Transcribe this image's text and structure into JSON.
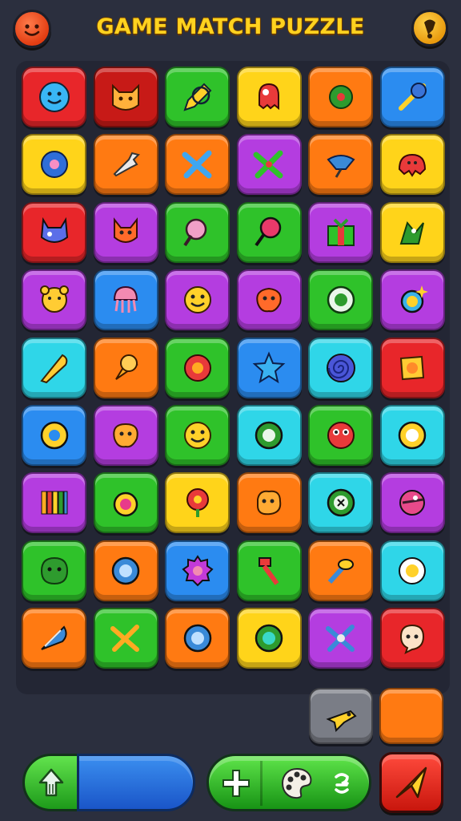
{
  "header": {
    "title": "GAME MATCH PUZZLE",
    "avatar_icon": "smiley-face-icon",
    "settings_icon": "bell-icon"
  },
  "colors": {
    "red": "#e8262a",
    "darkred": "#c71a17",
    "green": "#2fc22a",
    "yellow": "#ffd41a",
    "orange": "#ff7a12",
    "blue": "#2b8cf0",
    "purple": "#b43de0",
    "cyan": "#2fd6e8",
    "gray": "#7a7d86"
  },
  "board": {
    "rows": [
      [
        {
          "color": "red",
          "icon": "blue-smiley-icon"
        },
        {
          "color": "darkred",
          "icon": "cat-face-icon"
        },
        {
          "color": "green",
          "icon": "pencil-icon"
        },
        {
          "color": "yellow",
          "icon": "ghost-icon"
        },
        {
          "color": "orange",
          "icon": "gear-icon"
        },
        {
          "color": "blue",
          "icon": "broom-icon"
        }
      ],
      [
        {
          "color": "yellow",
          "icon": "donut-icon"
        },
        {
          "color": "orange",
          "icon": "wrench-icon"
        },
        {
          "color": "orange",
          "icon": "crossed-tools-icon"
        },
        {
          "color": "purple",
          "icon": "crossed-swords-icon"
        },
        {
          "color": "orange",
          "icon": "watering-can-icon"
        },
        {
          "color": "yellow",
          "icon": "red-monster-icon"
        }
      ],
      [
        {
          "color": "red",
          "icon": "horned-monster-icon"
        },
        {
          "color": "purple",
          "icon": "fox-face-icon"
        },
        {
          "color": "green",
          "icon": "lollipop-icon"
        },
        {
          "color": "green",
          "icon": "magnifier-icon"
        },
        {
          "color": "purple",
          "icon": "gift-box-icon"
        },
        {
          "color": "yellow",
          "icon": "bird-icon"
        }
      ],
      [
        {
          "color": "purple",
          "icon": "bear-face-icon"
        },
        {
          "color": "blue",
          "icon": "jellyfish-icon"
        },
        {
          "color": "purple",
          "icon": "yellow-smiley-icon"
        },
        {
          "color": "purple",
          "icon": "orange-blob-icon"
        },
        {
          "color": "green",
          "icon": "target-bubble-icon"
        },
        {
          "color": "purple",
          "icon": "sparkle-ring-icon"
        }
      ],
      [
        {
          "color": "cyan",
          "icon": "corn-cob-icon"
        },
        {
          "color": "orange",
          "icon": "carrot-icon"
        },
        {
          "color": "green",
          "icon": "flower-icon"
        },
        {
          "color": "blue",
          "icon": "star-icon"
        },
        {
          "color": "cyan",
          "icon": "spiral-icon"
        },
        {
          "color": "red",
          "icon": "swirl-candy-icon"
        }
      ],
      [
        {
          "color": "blue",
          "icon": "yellow-bubble-icon"
        },
        {
          "color": "purple",
          "icon": "blob-face-icon"
        },
        {
          "color": "green",
          "icon": "happy-face-icon"
        },
        {
          "color": "cyan",
          "icon": "green-bubble-icon"
        },
        {
          "color": "green",
          "icon": "red-monster-face-icon"
        },
        {
          "color": "cyan",
          "icon": "egg-icon"
        }
      ],
      [
        {
          "color": "purple",
          "icon": "crayons-icon"
        },
        {
          "color": "green",
          "icon": "potion-bubble-icon"
        },
        {
          "color": "yellow",
          "icon": "flower-bud-icon"
        },
        {
          "color": "orange",
          "icon": "cookie-icon"
        },
        {
          "color": "cyan",
          "icon": "clock-bubble-icon"
        },
        {
          "color": "purple",
          "icon": "bird-face-icon"
        }
      ],
      [
        {
          "color": "green",
          "icon": "green-blob-icon"
        },
        {
          "color": "orange",
          "icon": "blue-bubble-icon"
        },
        {
          "color": "blue",
          "icon": "purple-gear-icon"
        },
        {
          "color": "green",
          "icon": "hammer-icon"
        },
        {
          "color": "orange",
          "icon": "torch-icon"
        },
        {
          "color": "cyan",
          "icon": "fried-egg-icon"
        }
      ],
      [
        {
          "color": "orange",
          "icon": "feather-icon"
        },
        {
          "color": "green",
          "icon": "crossed-sticks-icon"
        },
        {
          "color": "orange",
          "icon": "blue-bubble-icon"
        },
        {
          "color": "yellow",
          "icon": "teal-bubble-icon"
        },
        {
          "color": "purple",
          "icon": "wrench-cross-icon"
        },
        {
          "color": "red",
          "icon": "ghost-face-icon"
        }
      ]
    ],
    "extra_tiles": [
      {
        "color": "gray",
        "icon": "bird-plane-icon"
      },
      {
        "color": "orange",
        "icon": "blank-tile-icon"
      }
    ]
  },
  "bottom_bar": {
    "up_icon": "up-arrow-icon",
    "progress": 0.0,
    "tools": [
      "plus-icon",
      "palette-icon",
      "coin-icon"
    ],
    "send_icon": "paper-plane-icon"
  }
}
